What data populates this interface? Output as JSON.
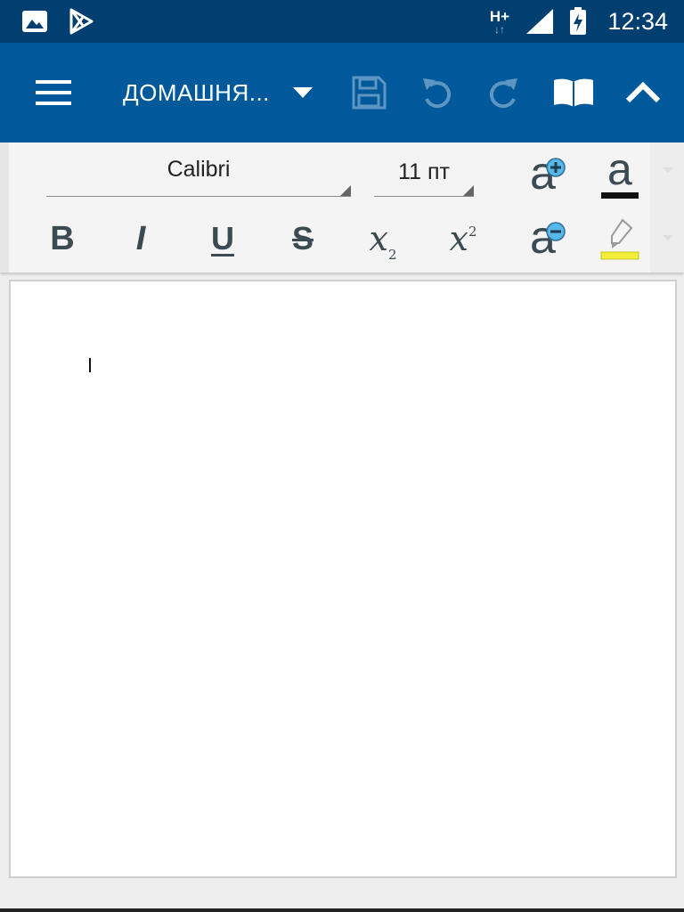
{
  "status_bar": {
    "time": "12:34",
    "network_label": "H+",
    "icons": [
      "image-icon",
      "play-store-icon",
      "network-arrows-icon",
      "signal-icon",
      "battery-charging-icon"
    ]
  },
  "app_bar": {
    "title": "ДОМАШНЯ...",
    "icons": [
      "menu-icon",
      "dropdown-arrow-icon",
      "save-icon",
      "undo-icon",
      "redo-icon",
      "read-mode-icon",
      "collapse-icon"
    ]
  },
  "ribbon": {
    "font_name": "Calibri",
    "font_size": "11 пт",
    "bold_label": "B",
    "italic_label": "I",
    "underline_label": "U",
    "strike_label": "S",
    "subscript_label": "x",
    "subscript_index": "2",
    "superscript_label": "x",
    "superscript_index": "2",
    "font_color_label": "a",
    "grow_label": "a",
    "shrink_label": "a"
  },
  "colors": {
    "status_bar": "#003f6f",
    "app_bar": "#00599a",
    "ribbon_bg": "#f4f4f4",
    "highlight_yellow": "#f2ee3a",
    "grow_shrink_badge": "#57b7e8",
    "icon_gray": "#3c4a52"
  }
}
